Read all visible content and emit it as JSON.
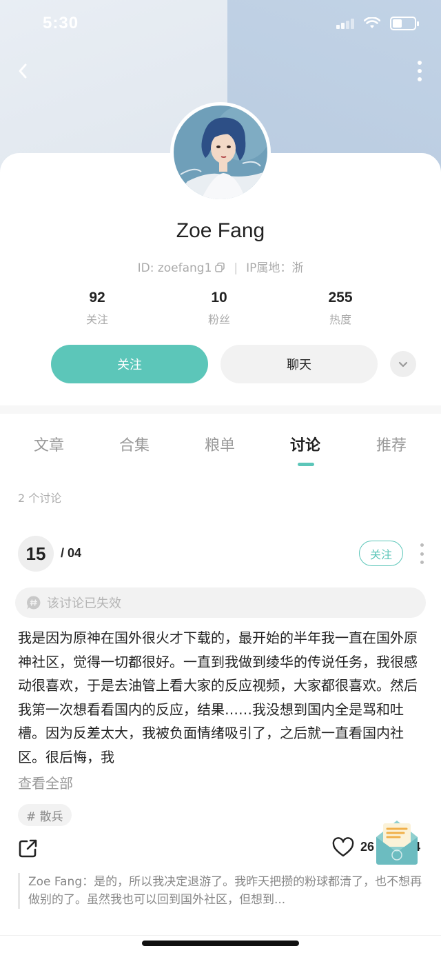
{
  "status_bar": {
    "time": "5:30"
  },
  "profile": {
    "name": "Zoe Fang",
    "id_label": "ID: zoefang1",
    "ip_label": "IP属地：浙",
    "stats": [
      {
        "value": "92",
        "label": "关注"
      },
      {
        "value": "10",
        "label": "粉丝"
      },
      {
        "value": "255",
        "label": "热度"
      }
    ],
    "follow_label": "关注",
    "chat_label": "聊天"
  },
  "tabs": [
    {
      "label": "文章",
      "active": false
    },
    {
      "label": "合集",
      "active": false
    },
    {
      "label": "粮单",
      "active": false
    },
    {
      "label": "讨论",
      "active": true
    },
    {
      "label": "推荐",
      "active": false
    }
  ],
  "discussion_count": "2 个讨论",
  "post": {
    "day": "15",
    "month": "/ 04",
    "follow_label": "关注",
    "expired_notice": "该讨论已失效",
    "body": "我是因为原神在国外很火才下载的，最开始的半年我一直在国外原神社区，觉得一切都很好。一直到我做到绫华的传说任务，我很感动很喜欢，于是去油管上看大家的反应视频，大家都很喜欢。然后我第一次想看看国内的反应，结果……我没想到国内全是骂和吐槽。因为反差太大，我被负面情绪吸引了，之后就一直看国内社区。很后悔，我",
    "see_all": "查看全部",
    "tag": "# 散兵",
    "like_count": "26",
    "like_count_tail": "4",
    "reply_author": "Zoe Fang：",
    "reply_text": "是的，所以我决定退游了。我昨天把攒的粉球都清了，也不想再做别的了。虽然我也可以回到国外社区，但想到..."
  },
  "colors": {
    "accent": "#5cc6b9"
  },
  "icons": [
    "back-icon",
    "more-icon",
    "copy-icon",
    "chevron-down-icon",
    "hash-bubble-icon",
    "share-icon",
    "heart-icon",
    "mail-icon"
  ]
}
